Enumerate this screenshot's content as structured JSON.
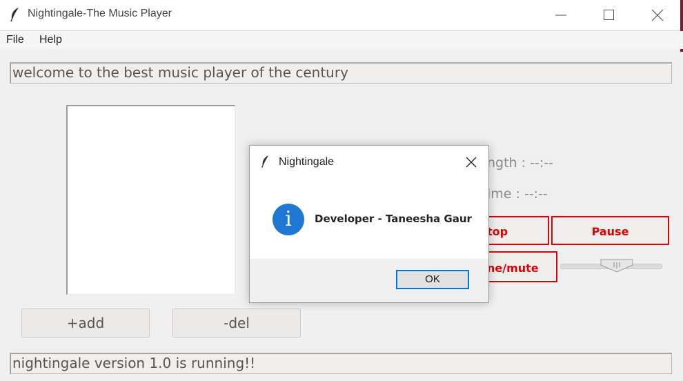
{
  "window": {
    "title": "Nightingale-The Music Player",
    "icon": "feather-icon",
    "controls": [
      "minimize",
      "maximize",
      "close"
    ]
  },
  "menu": {
    "items": [
      "File",
      "Help"
    ]
  },
  "welcome_text": "welcome to the best music player of the century",
  "playlist": {
    "items": []
  },
  "buttons": {
    "add": "+add",
    "del": "-del",
    "stop": "top",
    "pause": "Pause",
    "volume_mute": "ne/mute"
  },
  "info": {
    "length": "ngth : --:--",
    "time": "ime : --:--"
  },
  "status_text": "nightingale version 1.0 is running!!",
  "dialog": {
    "title": "Nightingale",
    "icon": "info-icon",
    "message": "Developer - Taneesha Gaur",
    "ok_label": "OK"
  },
  "colors": {
    "accent_red": "#e00000",
    "info_blue": "#1e78d1",
    "focus_blue": "#0078d7"
  }
}
